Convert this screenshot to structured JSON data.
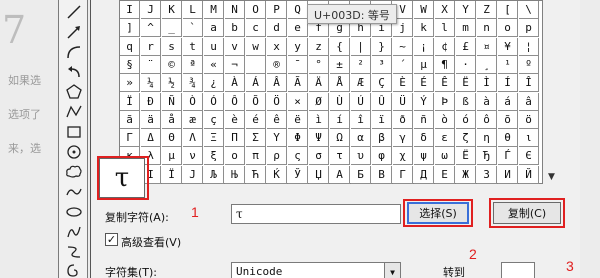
{
  "background": {
    "heading": "7",
    "lines": [
      "如果选",
      "选项了",
      "来，选"
    ]
  },
  "toolbar": {
    "tools": [
      "line-tool-icon",
      "arrow-tool-icon",
      "curve-tool-icon",
      "undo-arrow-icon",
      "pentagon-icon",
      "polyline-icon",
      "rectangle-icon",
      "circle-icon",
      "cloud-icon",
      "wave-icon",
      "ellipse-icon",
      "freeform-icon",
      "snake-icon",
      "spiral-icon"
    ]
  },
  "char_grid": {
    "rows": [
      [
        "I",
        "J",
        "K",
        "L",
        "M",
        "N",
        "O",
        "P",
        "Q",
        "R",
        "S",
        "T",
        "U",
        "V",
        "W",
        "X",
        "Y",
        "Z",
        "[",
        "\\"
      ],
      [
        "]",
        "^",
        "_",
        "`",
        "a",
        "b",
        "c",
        "d",
        "e",
        "f",
        "g",
        "h",
        "i",
        "j",
        "k",
        "l",
        "m",
        "n",
        "o",
        "p"
      ],
      [
        "q",
        "r",
        "s",
        "t",
        "u",
        "v",
        "w",
        "x",
        "y",
        "z",
        "{",
        "|",
        "}",
        "~",
        "¡",
        "¢",
        "£",
        "¤",
        "¥",
        "¦"
      ],
      [
        "§",
        "¨",
        "©",
        "ª",
        "«",
        "¬",
        "­",
        "®",
        "¯",
        "°",
        "±",
        "²",
        "³",
        "´",
        "µ",
        "¶",
        "·",
        "¸",
        "¹",
        "º"
      ],
      [
        "»",
        "¼",
        "½",
        "¾",
        "¿",
        "À",
        "Á",
        "Â",
        "Ã",
        "Ä",
        "Å",
        "Æ",
        "Ç",
        "È",
        "É",
        "Ê",
        "Ë",
        "Ì",
        "Í",
        "Î"
      ],
      [
        "Ï",
        "Ð",
        "Ñ",
        "Ò",
        "Ó",
        "Ô",
        "Õ",
        "Ö",
        "×",
        "Ø",
        "Ù",
        "Ú",
        "Û",
        "Ü",
        "Ý",
        "Þ",
        "ß",
        "à",
        "á",
        "â"
      ],
      [
        "ã",
        "ä",
        "å",
        "æ",
        "ç",
        "è",
        "é",
        "ê",
        "ë",
        "ì",
        "í",
        "î",
        "ï",
        "ð",
        "ñ",
        "ò",
        "ó",
        "ô",
        "õ",
        "ö"
      ],
      [
        "Γ",
        "Δ",
        "Θ",
        "Λ",
        "Ξ",
        "Π",
        "Σ",
        "Υ",
        "Φ",
        "Ψ",
        "Ω",
        "α",
        "β",
        "γ",
        "δ",
        "ε",
        "ζ",
        "η",
        "θ",
        "ι"
      ],
      [
        "κ",
        "λ",
        "μ",
        "ν",
        "ξ",
        "ο",
        "π",
        "ρ",
        "ς",
        "σ",
        "τ",
        "υ",
        "φ",
        "χ",
        "ψ",
        "ω",
        "Ё",
        "Ђ",
        "Ѓ",
        "Є"
      ],
      [
        "Ѕ",
        "І",
        "Ї",
        "Ј",
        "Љ",
        "Њ",
        "Ћ",
        "Ќ",
        "Ў",
        "Џ",
        "А",
        "Б",
        "В",
        "Г",
        "Д",
        "Е",
        "Ж",
        "З",
        "И",
        "Й"
      ]
    ]
  },
  "tooltip": "U+003D: 等号",
  "preview_char": "τ",
  "form": {
    "copy_chars_label": "复制字符(A):",
    "copy_chars_value": "τ",
    "select_button": "选择(S)",
    "copy_button": "复制(C)",
    "advanced_view_label": "高级查看(V)",
    "advanced_view_checked": "✓",
    "charset_label": "字符集(T):",
    "charset_value": "Unicode",
    "goto_label": "转到"
  },
  "annotations": {
    "n1": "1",
    "n2": "2",
    "n3": "3"
  },
  "colors": {
    "highlight": "#e02020",
    "focus": "#3a6fd8"
  }
}
